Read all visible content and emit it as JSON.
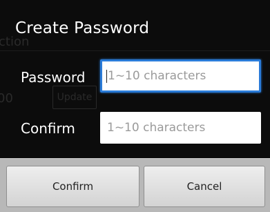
{
  "dialog": {
    "title": "Create Password"
  },
  "background": {
    "text1": "ction",
    "text2": "00",
    "button_label": "Update"
  },
  "form": {
    "password": {
      "label": "Password",
      "placeholder": "1~10 characters"
    },
    "confirm": {
      "label": "Confirm",
      "placeholder": "1~10 characters"
    }
  },
  "buttons": {
    "confirm_label": "Confirm",
    "cancel_label": "Cancel"
  },
  "colors": {
    "focus": "#2a7bd8",
    "background": "#0c0c0c",
    "button_bar": "#b8b8b8"
  }
}
